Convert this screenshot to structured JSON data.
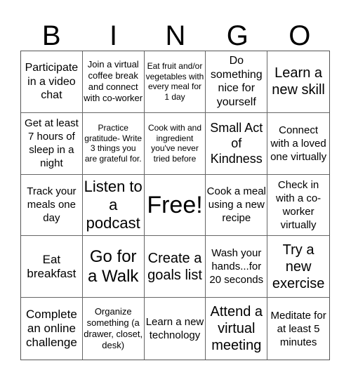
{
  "header": {
    "letters": [
      "B",
      "I",
      "N",
      "G",
      "O"
    ]
  },
  "cells": [
    {
      "text": "Participate in a video chat",
      "size": "s16"
    },
    {
      "text": "Join a virtual coffee break and connect with co-worker",
      "size": "s13"
    },
    {
      "text": "Eat fruit and/or vegetables with every meal for 1 day",
      "size": "s12"
    },
    {
      "text": "Do something nice for yourself",
      "size": "s16"
    },
    {
      "text": "Learn a new skill",
      "size": "s20"
    },
    {
      "text": "Get at least 7 hours of sleep in a night",
      "size": "s15"
    },
    {
      "text": "Practice gratitude- Write 3 things you are grateful for.",
      "size": "s12"
    },
    {
      "text": "Cook with and ingredient you've never tried before",
      "size": "s12"
    },
    {
      "text": "Small Act of Kindness",
      "size": "s18"
    },
    {
      "text": "Connect with a loved one virtually",
      "size": "s15"
    },
    {
      "text": "Track your meals one day",
      "size": "s15"
    },
    {
      "text": "Listen to a podcast",
      "size": "s22"
    },
    {
      "text": "Free!",
      "size": "s34"
    },
    {
      "text": "Cook a meal using a new recipe",
      "size": "s15"
    },
    {
      "text": "Check in with a co-worker virtually",
      "size": "s15"
    },
    {
      "text": "Eat breakfast",
      "size": "s17"
    },
    {
      "text": "Go for a Walk",
      "size": "s24"
    },
    {
      "text": "Create a goals list",
      "size": "s20"
    },
    {
      "text": "Wash your hands...for 20 seconds",
      "size": "s15"
    },
    {
      "text": "Try a new exercise",
      "size": "s20"
    },
    {
      "text": "Complete an online challenge",
      "size": "s17"
    },
    {
      "text": "Organize something (a drawer, closet, desk)",
      "size": "s13"
    },
    {
      "text": "Learn a new technology",
      "size": "s15"
    },
    {
      "text": "Attend a virtual meeting",
      "size": "s20"
    },
    {
      "text": "Meditate for at least 5 minutes",
      "size": "s15"
    }
  ]
}
